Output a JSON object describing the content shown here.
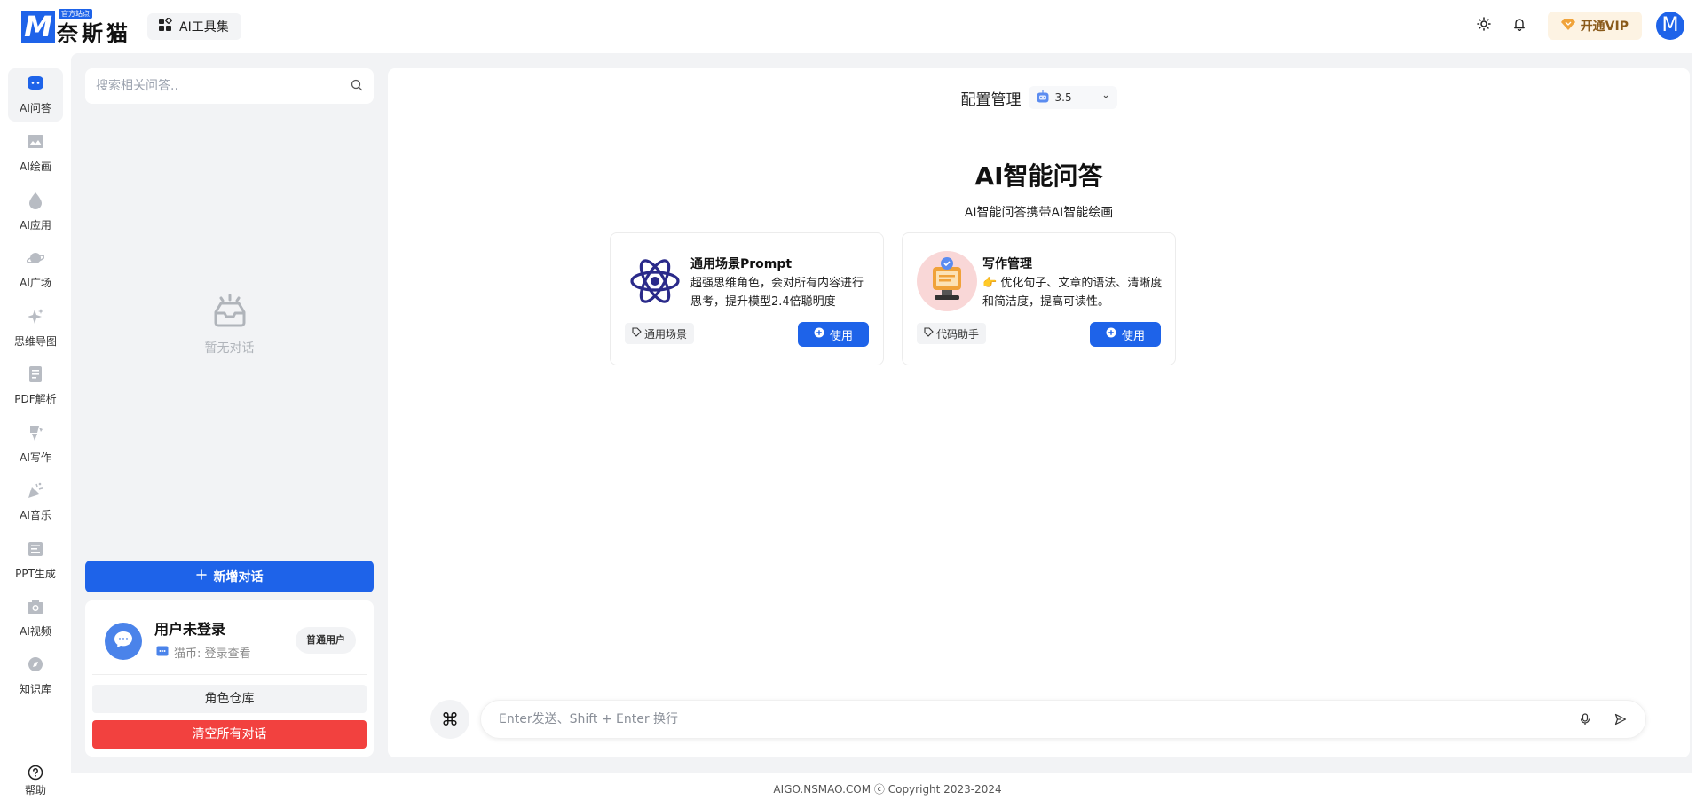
{
  "header": {
    "logo_badge": "官方站点",
    "logo_letter": "M",
    "logo_text": "奈斯猫",
    "tools_label": "AI工具集",
    "vip_label": "开通VIP",
    "avatar_letter": "M"
  },
  "nav": {
    "items": [
      {
        "label": "AI问答",
        "icon": "chat-bubble-icon"
      },
      {
        "label": "AI绘画",
        "icon": "image-icon"
      },
      {
        "label": "AI应用",
        "icon": "drop-icon"
      },
      {
        "label": "AI广场",
        "icon": "planet-icon"
      },
      {
        "label": "思维导图",
        "icon": "sparkle-icon"
      },
      {
        "label": "PDF解析",
        "icon": "document-icon"
      },
      {
        "label": "AI写作",
        "icon": "pen-icon"
      },
      {
        "label": "AI音乐",
        "icon": "party-icon"
      },
      {
        "label": "PPT生成",
        "icon": "slides-icon"
      },
      {
        "label": "AI视频",
        "icon": "camera-icon"
      },
      {
        "label": "知识库",
        "icon": "compass-icon"
      }
    ],
    "help_label": "帮助"
  },
  "sidebar": {
    "search_placeholder": "搜索相关问答..",
    "empty_text": "暂无对话",
    "new_chat_label": "新增对话",
    "user": {
      "name": "用户未登录",
      "coins": "猫币: 登录查看",
      "badge": "普通用户"
    },
    "role_library_label": "角色仓库",
    "clear_all_label": "清空所有对话"
  },
  "chat": {
    "config_label": "配置管理",
    "model_value": "3.5",
    "title": "AI智能问答",
    "subtitle": "AI智能问答携带AI智能绘画",
    "cards": [
      {
        "title": "通用场景Prompt",
        "desc": "超强思维角色，会对所有内容进行思考，提升模型2.4倍聪明度",
        "tag": "通用场景",
        "use_label": "使用"
      },
      {
        "title": "写作管理",
        "desc": "👉 优化句子、文章的语法、清晰度和简洁度，提高可读性。",
        "tag": "代码助手",
        "use_label": "使用"
      }
    ],
    "input_placeholder": "Enter发送、Shift + Enter 换行"
  },
  "footer": {
    "text": "AIGO.NSMAO.COM ⓒ Copyright 2023-2024"
  },
  "colors": {
    "accent": "#1e63e9",
    "danger": "#f2413f",
    "panel_bg": "#f2f3f5",
    "vip_bg": "#fdf3e3"
  }
}
